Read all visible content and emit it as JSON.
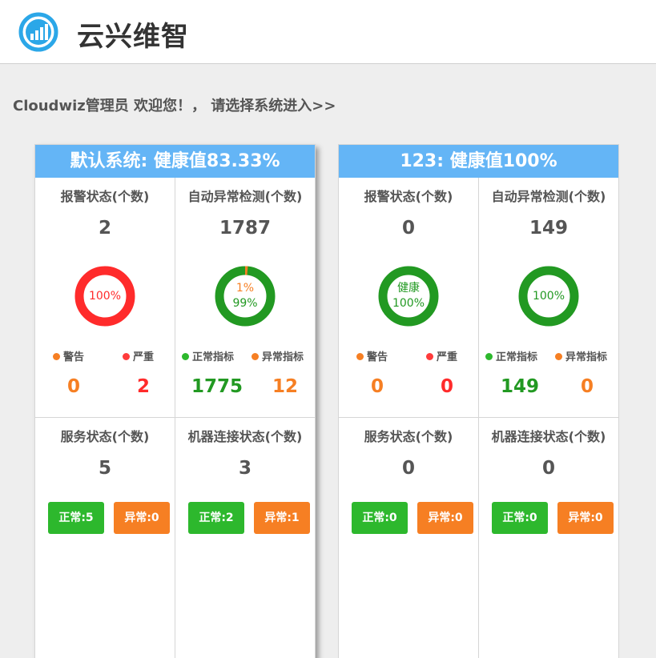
{
  "app": {
    "title": "云兴维智",
    "logo": "bar-chart-logo-icon"
  },
  "welcome": "Cloudwiz管理员 欢迎您！， 请选择系统进入>>",
  "colors": {
    "header_blue": "#64b5f6",
    "red": "#ff2b2b",
    "orange": "#f67f23",
    "green": "#2db82d",
    "ring_green": "#229922"
  },
  "systems": [
    {
      "title": "默认系统: 健康值83.33%",
      "alert": {
        "label": "报警状态(个数)",
        "count": "2",
        "ring_text": "100%",
        "legend": [
          "警告",
          "严重"
        ],
        "values": [
          "0",
          "2"
        ],
        "warning_fraction": 0,
        "severe_fraction": 1.0
      },
      "anomaly": {
        "label": "自动异常检测(个数)",
        "count": "1787",
        "ring_text_top": "1%",
        "ring_text_bottom": "99%",
        "legend": [
          "正常指标",
          "异常指标"
        ],
        "values": [
          "1775",
          "12"
        ],
        "abnormal_fraction": 0.01
      },
      "service": {
        "label": "服务状态(个数)",
        "count": "5",
        "ok_label": "正常:5",
        "err_label": "异常:0"
      },
      "machine": {
        "label": "机器连接状态(个数)",
        "count": "3",
        "ok_label": "正常:2",
        "err_label": "异常:1"
      }
    },
    {
      "title": "123: 健康值100%",
      "alert": {
        "label": "报警状态(个数)",
        "count": "0",
        "ring_text_top": "健康",
        "ring_text_bottom": "100%",
        "legend": [
          "警告",
          "严重"
        ],
        "values": [
          "0",
          "0"
        ],
        "healthy_fraction": 1.0
      },
      "anomaly": {
        "label": "自动异常检测(个数)",
        "count": "149",
        "ring_text": "100%",
        "legend": [
          "正常指标",
          "异常指标"
        ],
        "values": [
          "149",
          "0"
        ],
        "abnormal_fraction": 0
      },
      "service": {
        "label": "服务状态(个数)",
        "count": "0",
        "ok_label": "正常:0",
        "err_label": "异常:0"
      },
      "machine": {
        "label": "机器连接状态(个数)",
        "count": "0",
        "ok_label": "正常:0",
        "err_label": "异常:0"
      }
    }
  ]
}
